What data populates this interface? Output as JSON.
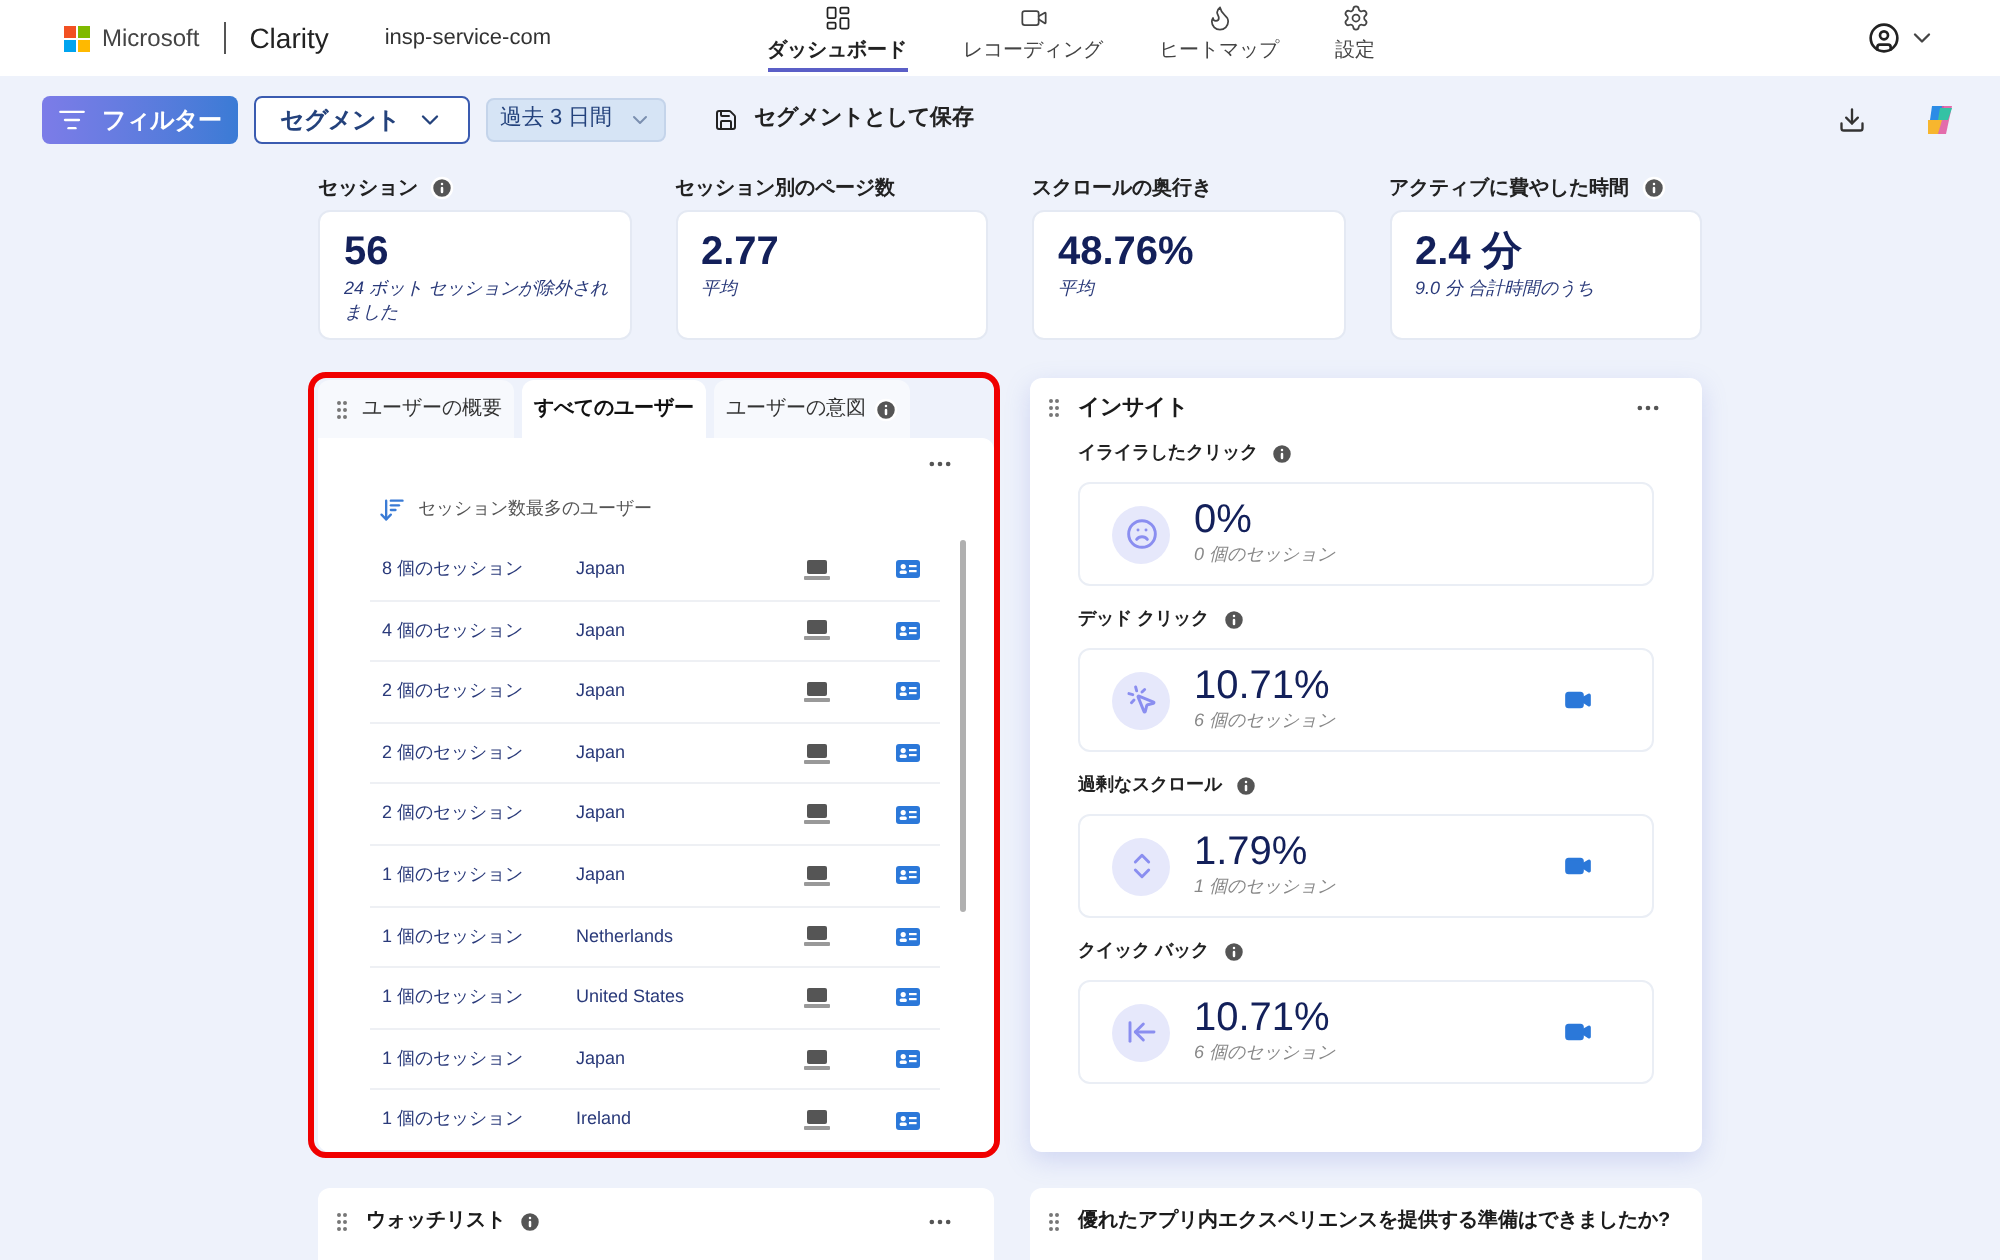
{
  "header": {
    "brand": "Microsoft",
    "product": "Clarity",
    "project": "insp-service-com",
    "nav": [
      {
        "label": "ダッシュボード",
        "kind": "dashboard",
        "selected": true
      },
      {
        "label": "レコーディング",
        "kind": "video",
        "selected": false
      },
      {
        "label": "ヒートマップ",
        "kind": "flame",
        "selected": false
      },
      {
        "label": "設定",
        "kind": "settings",
        "selected": false
      }
    ]
  },
  "toolbar": {
    "filter": "フィルター",
    "segment": "セグメント",
    "range": "過去 3 日間",
    "save": "セグメントとして保存"
  },
  "stats": [
    {
      "label": "セッション",
      "info": true,
      "value": "56",
      "sub": "24 ボット セッションが除外されました"
    },
    {
      "label": "セッション別のページ数",
      "info": false,
      "value": "2.77",
      "sub": "平均"
    },
    {
      "label": "スクロールの奥行き",
      "info": false,
      "value": "48.76%",
      "sub": "平均"
    },
    {
      "label": "アクティブに費やした時間",
      "info": true,
      "value": "2.4 分",
      "sub": "9.0 分 合計時間のうち"
    }
  ],
  "users_panel": {
    "highlighted": true,
    "tabs": [
      {
        "label": "ユーザーの概要",
        "selected": false,
        "info": false
      },
      {
        "label": "すべてのユーザー",
        "selected": true,
        "info": false
      },
      {
        "label": "ユーザーの意図",
        "selected": false,
        "info": true
      }
    ],
    "sort_label": "セッション数最多のユーザー",
    "rows": [
      {
        "sessions": "8 個のセッション",
        "country": "Japan"
      },
      {
        "sessions": "4 個のセッション",
        "country": "Japan"
      },
      {
        "sessions": "2 個のセッション",
        "country": "Japan"
      },
      {
        "sessions": "2 個のセッション",
        "country": "Japan"
      },
      {
        "sessions": "2 個のセッション",
        "country": "Japan"
      },
      {
        "sessions": "1 個のセッション",
        "country": "Japan"
      },
      {
        "sessions": "1 個のセッション",
        "country": "Netherlands"
      },
      {
        "sessions": "1 個のセッション",
        "country": "United States"
      },
      {
        "sessions": "1 個のセッション",
        "country": "Japan"
      },
      {
        "sessions": "1 個のセッション",
        "country": "Ireland"
      }
    ]
  },
  "insights": {
    "title": "インサイト",
    "items": [
      {
        "label": "イライラしたクリック",
        "kind": "frown",
        "value": "0%",
        "sub": "0 個のセッション",
        "recording": false
      },
      {
        "label": "デッド クリック",
        "kind": "pointer",
        "value": "10.71%",
        "sub": "6 個のセッション",
        "recording": true
      },
      {
        "label": "過剰なスクロール",
        "kind": "scroll",
        "value": "1.79%",
        "sub": "1 個のセッション",
        "recording": true
      },
      {
        "label": "クイック バック",
        "kind": "back",
        "value": "10.71%",
        "sub": "6 個のセッション",
        "recording": true
      }
    ]
  },
  "bottom_cards": [
    {
      "title": "ウォッチリスト",
      "info": true,
      "menu": true
    },
    {
      "title": "優れたアプリ内エクスペリエンスを提供する準備はできましたか?",
      "info": false,
      "menu": false
    }
  ]
}
